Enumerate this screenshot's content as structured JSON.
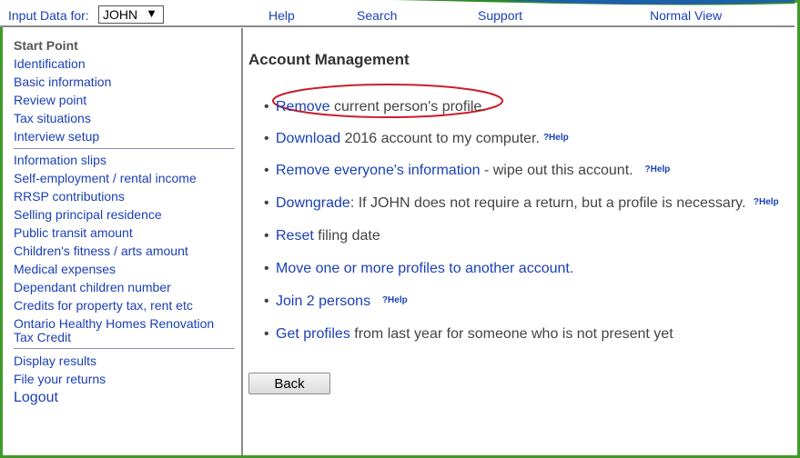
{
  "topbar": {
    "input_label": "Input Data for:",
    "person": "JOHN",
    "links": {
      "help": "Help",
      "search": "Search",
      "support": "Support",
      "view": "Normal View"
    }
  },
  "sidebar": {
    "start_point": "Start Point",
    "group1": [
      "Identification",
      "Basic information",
      "Review point",
      "Tax situations",
      "Interview setup"
    ],
    "group2": [
      "Information slips",
      "Self-employment / rental income",
      "RRSP contributions",
      "Selling principal residence",
      "Public transit amount",
      "Children's fitness / arts amount",
      "Medical expenses",
      "Dependant children number",
      "Credits for property tax, rent etc",
      "Ontario Healthy Homes Renovation Tax Credit"
    ],
    "group3": [
      "Display results",
      "File your returns"
    ],
    "logout": "Logout"
  },
  "main": {
    "title": "Account Management",
    "help_label": "?Help",
    "items": [
      {
        "link": "Remove",
        "text": " current person's profile."
      },
      {
        "link": "Download",
        "text": " 2016 account to my computer."
      },
      {
        "link": "Remove everyone's information",
        "text": " - wipe out this account."
      },
      {
        "link": "Downgrade",
        "text": ": If JOHN does not require a return, but a profile is necessary."
      },
      {
        "link": "Reset",
        "text": " filing date"
      },
      {
        "link": "Move one or more profiles to another account.",
        "text": ""
      },
      {
        "link": "Join 2 persons",
        "text": ""
      },
      {
        "link": "Get profiles",
        "text": " from last year for someone who is not present yet"
      }
    ],
    "back_label": "Back"
  },
  "colors": {
    "frame": "#3f9a2a",
    "link": "#1a3fb5",
    "highlight": "#c8202a"
  }
}
